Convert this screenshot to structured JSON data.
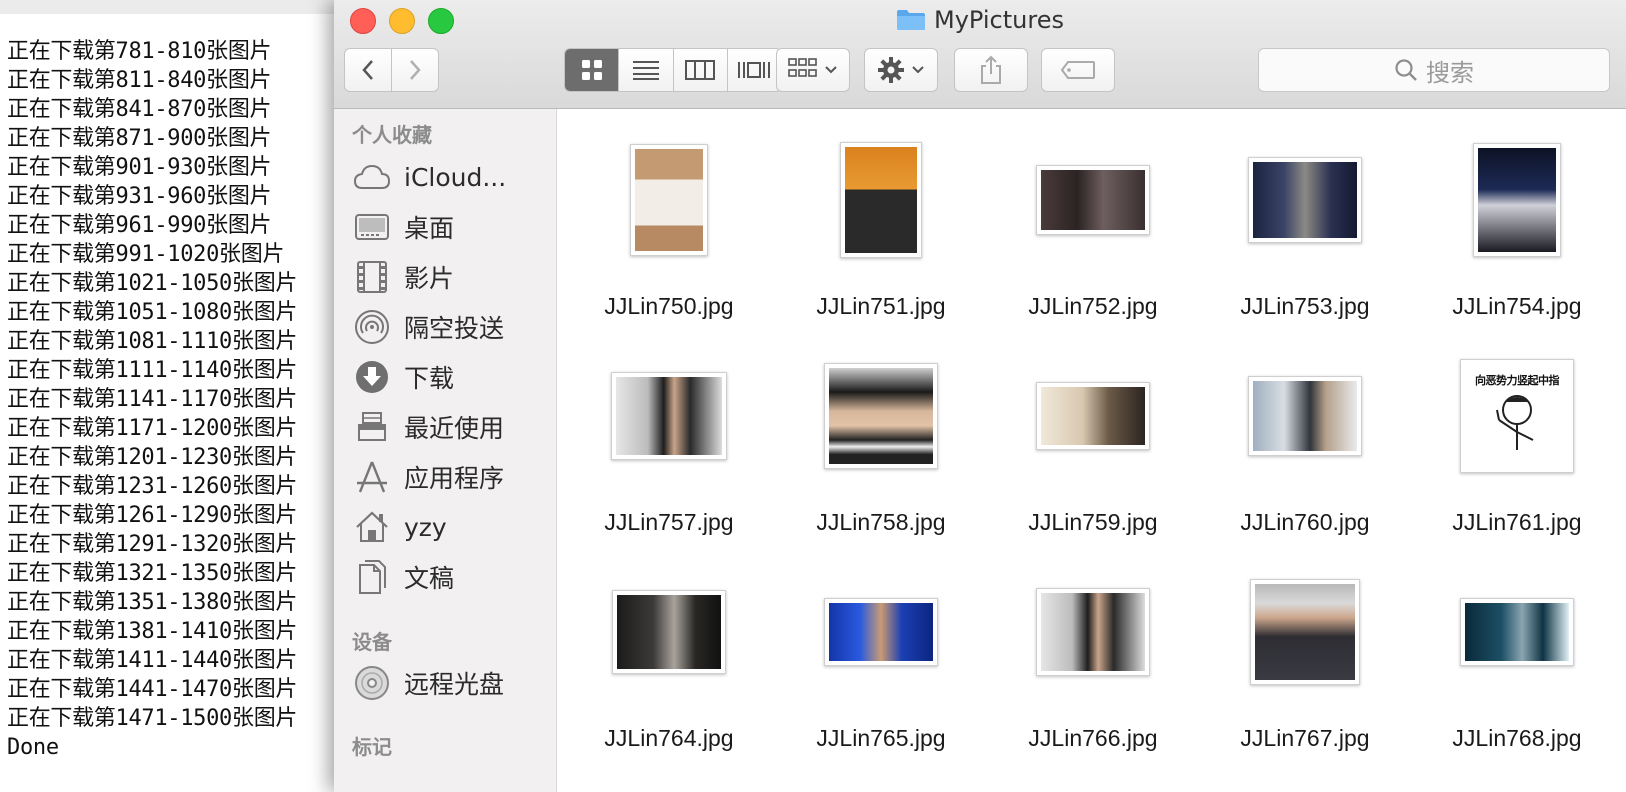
{
  "terminal": {
    "lines": [
      "正在下载第781-810张图片",
      "正在下载第811-840张图片",
      "正在下载第841-870张图片",
      "正在下载第871-900张图片",
      "正在下载第901-930张图片",
      "正在下载第931-960张图片",
      "正在下载第961-990张图片",
      "正在下载第991-1020张图片",
      "正在下载第1021-1050张图片",
      "正在下载第1051-1080张图片",
      "正在下载第1081-1110张图片",
      "正在下载第1111-1140张图片",
      "正在下载第1141-1170张图片",
      "正在下载第1171-1200张图片",
      "正在下载第1201-1230张图片",
      "正在下载第1231-1260张图片",
      "正在下载第1261-1290张图片",
      "正在下载第1291-1320张图片",
      "正在下载第1321-1350张图片",
      "正在下载第1351-1380张图片",
      "正在下载第1381-1410张图片",
      "正在下载第1411-1440张图片",
      "正在下载第1441-1470张图片",
      "正在下载第1471-1500张图片",
      "Done"
    ]
  },
  "window": {
    "title": "MyPictures",
    "search_placeholder": "搜索"
  },
  "sidebar": {
    "favorites_header": "个人收藏",
    "devices_header": "设备",
    "tags_header": "标记",
    "favorites": [
      {
        "label": "iCloud...",
        "icon": "cloud-icon"
      },
      {
        "label": "桌面",
        "icon": "desktop-icon"
      },
      {
        "label": "影片",
        "icon": "film-icon"
      },
      {
        "label": "隔空投送",
        "icon": "airdrop-icon"
      },
      {
        "label": "下载",
        "icon": "download-icon"
      },
      {
        "label": "最近使用",
        "icon": "recents-icon"
      },
      {
        "label": "应用程序",
        "icon": "applications-icon"
      },
      {
        "label": "yzy",
        "icon": "home-icon"
      },
      {
        "label": "文稿",
        "icon": "documents-icon"
      }
    ],
    "devices": [
      {
        "label": "远程光盘",
        "icon": "disc-icon"
      }
    ]
  },
  "files": [
    {
      "name": "JJLin750.jpg"
    },
    {
      "name": "JJLin751.jpg"
    },
    {
      "name": "JJLin752.jpg"
    },
    {
      "name": "JJLin753.jpg"
    },
    {
      "name": "JJLin754.jpg"
    },
    {
      "name": "JJLin757.jpg"
    },
    {
      "name": "JJLin758.jpg"
    },
    {
      "name": "JJLin759.jpg"
    },
    {
      "name": "JJLin760.jpg"
    },
    {
      "name": "JJLin761.jpg",
      "caption": "向恶势力竖起中指"
    },
    {
      "name": "JJLin764.jpg"
    },
    {
      "name": "JJLin765.jpg"
    },
    {
      "name": "JJLin766.jpg"
    },
    {
      "name": "JJLin767.jpg"
    },
    {
      "name": "JJLin768.jpg"
    }
  ],
  "colors": {
    "close": "#ff5f57",
    "minimize": "#febc2e",
    "zoom": "#28c840",
    "folder": "#5aa8ec"
  }
}
